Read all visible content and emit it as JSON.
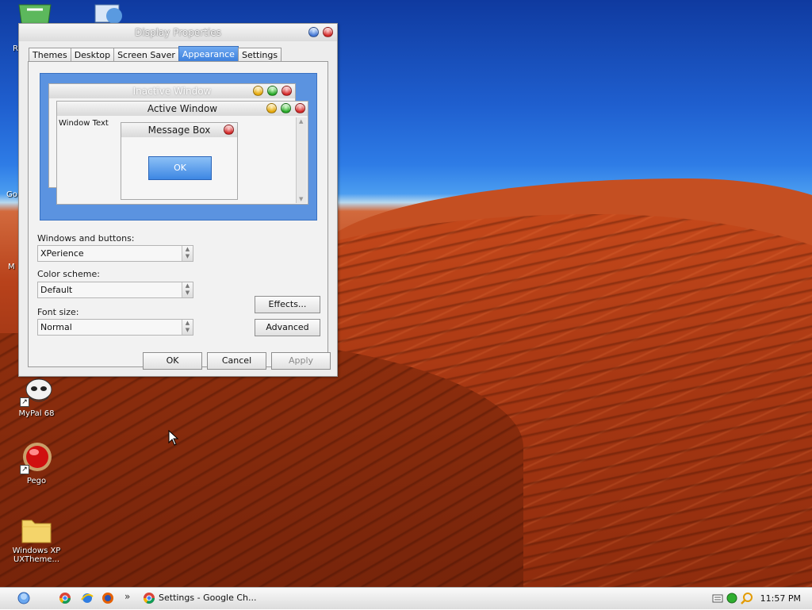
{
  "window": {
    "title": "Display Properties",
    "tabs": [
      {
        "label": "Themes"
      },
      {
        "label": "Desktop"
      },
      {
        "label": "Screen Saver"
      },
      {
        "label": "Appearance"
      },
      {
        "label": "Settings"
      }
    ],
    "active_tab": "Appearance",
    "preview": {
      "inactive_title": "Inactive Window",
      "active_title": "Active Window",
      "window_text": "Window Text",
      "message_box_title": "Message Box",
      "ok_label": "OK"
    },
    "fields": {
      "windows_buttons_label": "Windows and buttons:",
      "windows_buttons_value": "XPerience",
      "color_scheme_label": "Color scheme:",
      "color_scheme_value": "Default",
      "font_size_label": "Font size:",
      "font_size_value": "Normal"
    },
    "buttons": {
      "effects": "Effects...",
      "advanced": "Advanced",
      "ok": "OK",
      "cancel": "Cancel",
      "apply": "Apply"
    }
  },
  "desktop": {
    "icons": [
      {
        "label": "MyPal 68"
      },
      {
        "label": "Pego"
      },
      {
        "label": "Windows XP UXTheme..."
      }
    ],
    "partial_labels": {
      "r": "R",
      "go": "Go",
      "m": "M"
    }
  },
  "taskbar": {
    "task_label": "Settings - Google Ch...",
    "overflow": "»",
    "clock": "11:57 PM"
  },
  "colors": {
    "accent_tab": "#3b7fdc",
    "sky": "#1f5fcf",
    "sand": "#a83813"
  }
}
